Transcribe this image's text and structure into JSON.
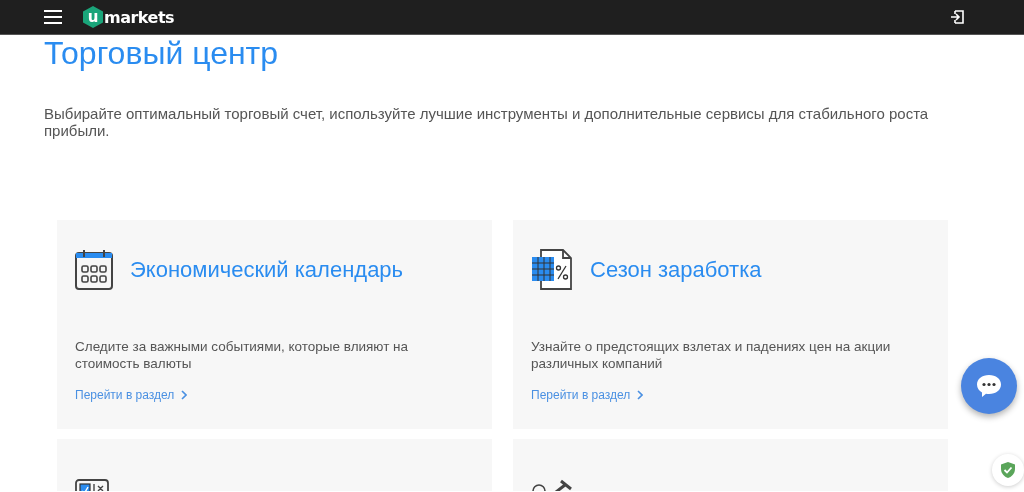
{
  "header": {
    "logo": {
      "mark": "u",
      "text": "markets"
    }
  },
  "page": {
    "title": "Торговый центр",
    "description": "Выбирайте оптимальный торговый счет, используйте лучшие инструменты и дополнительные сервисы для стабильного роста прибыли."
  },
  "cards": [
    {
      "kind": "full",
      "title": "Экономический календарь",
      "description": "Следите за важными событиями, которые влияют на стоимость валюты",
      "link": "Перейти в раздел"
    },
    {
      "kind": "full",
      "title": "Сезон заработка",
      "description": "Узнайте о предстоящих взлетах и падениях цен на акции различных компаний",
      "link": "Перейти в раздел"
    },
    {
      "kind": "partial"
    },
    {
      "kind": "partial"
    }
  ]
}
